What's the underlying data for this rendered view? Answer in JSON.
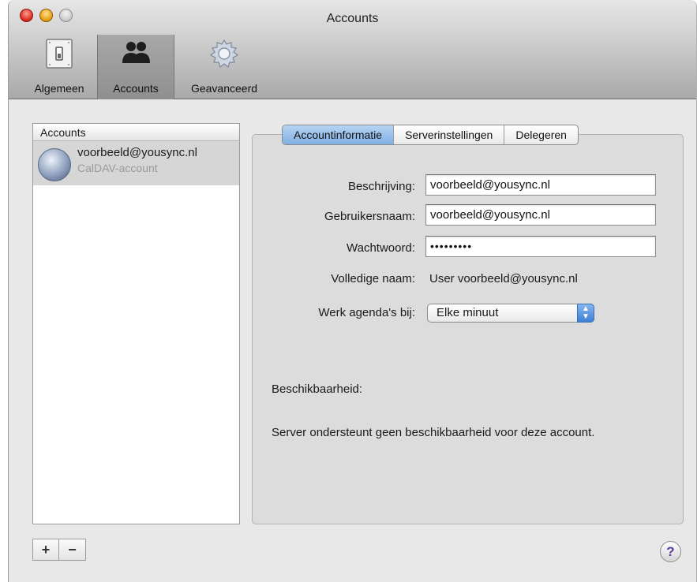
{
  "window": {
    "title": "Accounts"
  },
  "toolbar": {
    "items": [
      {
        "label": "Algemeen",
        "icon": "switch-icon"
      },
      {
        "label": "Accounts",
        "icon": "people-icon"
      },
      {
        "label": "Geavanceerd",
        "icon": "gear-icon"
      }
    ]
  },
  "sidebar": {
    "header": "Accounts",
    "accounts": [
      {
        "name": "voorbeeld@yousync.nl",
        "type": "CalDAV-account",
        "icon": "globe-icon"
      }
    ],
    "add_label": "+",
    "remove_label": "−"
  },
  "tabs": [
    "Accountinformatie",
    "Serverinstellingen",
    "Delegeren"
  ],
  "form": {
    "description": {
      "label": "Beschrijving:",
      "value": "voorbeeld@yousync.nl"
    },
    "username": {
      "label": "Gebruikersnaam:",
      "value": "voorbeeld@yousync.nl"
    },
    "password": {
      "label": "Wachtwoord:",
      "value": "•••••••••"
    },
    "fullname": {
      "label": "Volledige naam:",
      "value": "User voorbeeld@yousync.nl"
    },
    "refresh": {
      "label": "Werk agenda's bij:",
      "value": "Elke minuut"
    }
  },
  "availability": {
    "label": "Beschikbaarheid:",
    "message": "Server ondersteunt geen beschikbaarheid voor deze account."
  },
  "help": {
    "label": "?"
  }
}
